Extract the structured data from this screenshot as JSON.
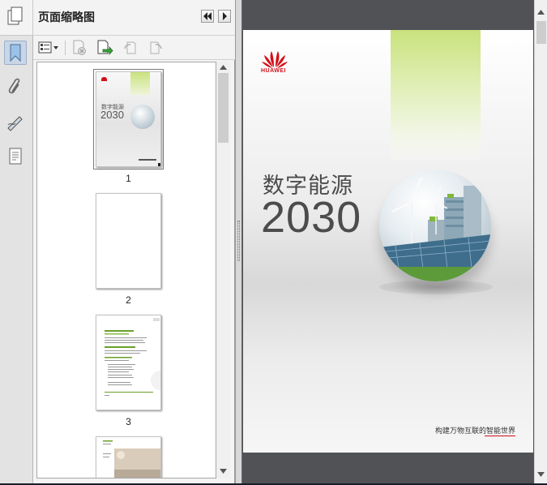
{
  "panel": {
    "title": "页面缩略图",
    "collapse_label": "◀◀",
    "expand_label": "▶"
  },
  "toolbar": {
    "icons": [
      "thumbnail-options-icon",
      "delete-page-icon",
      "extract-page-icon",
      "rotate-left-icon",
      "rotate-right-icon"
    ]
  },
  "thumbnails": [
    {
      "label": "1"
    },
    {
      "label": "2"
    },
    {
      "label": "3"
    },
    {
      "label": ""
    }
  ],
  "cover": {
    "brand": "HUAWEI",
    "title": "数字能源",
    "year": "2030",
    "footer": "构建万物互联的智能世界"
  },
  "thumb1": {
    "title": "数字能源",
    "year": "2030"
  },
  "colors": {
    "brand_red": "#d40f17",
    "accent_green": "#c9e27d",
    "viewer_bg": "#505256"
  }
}
